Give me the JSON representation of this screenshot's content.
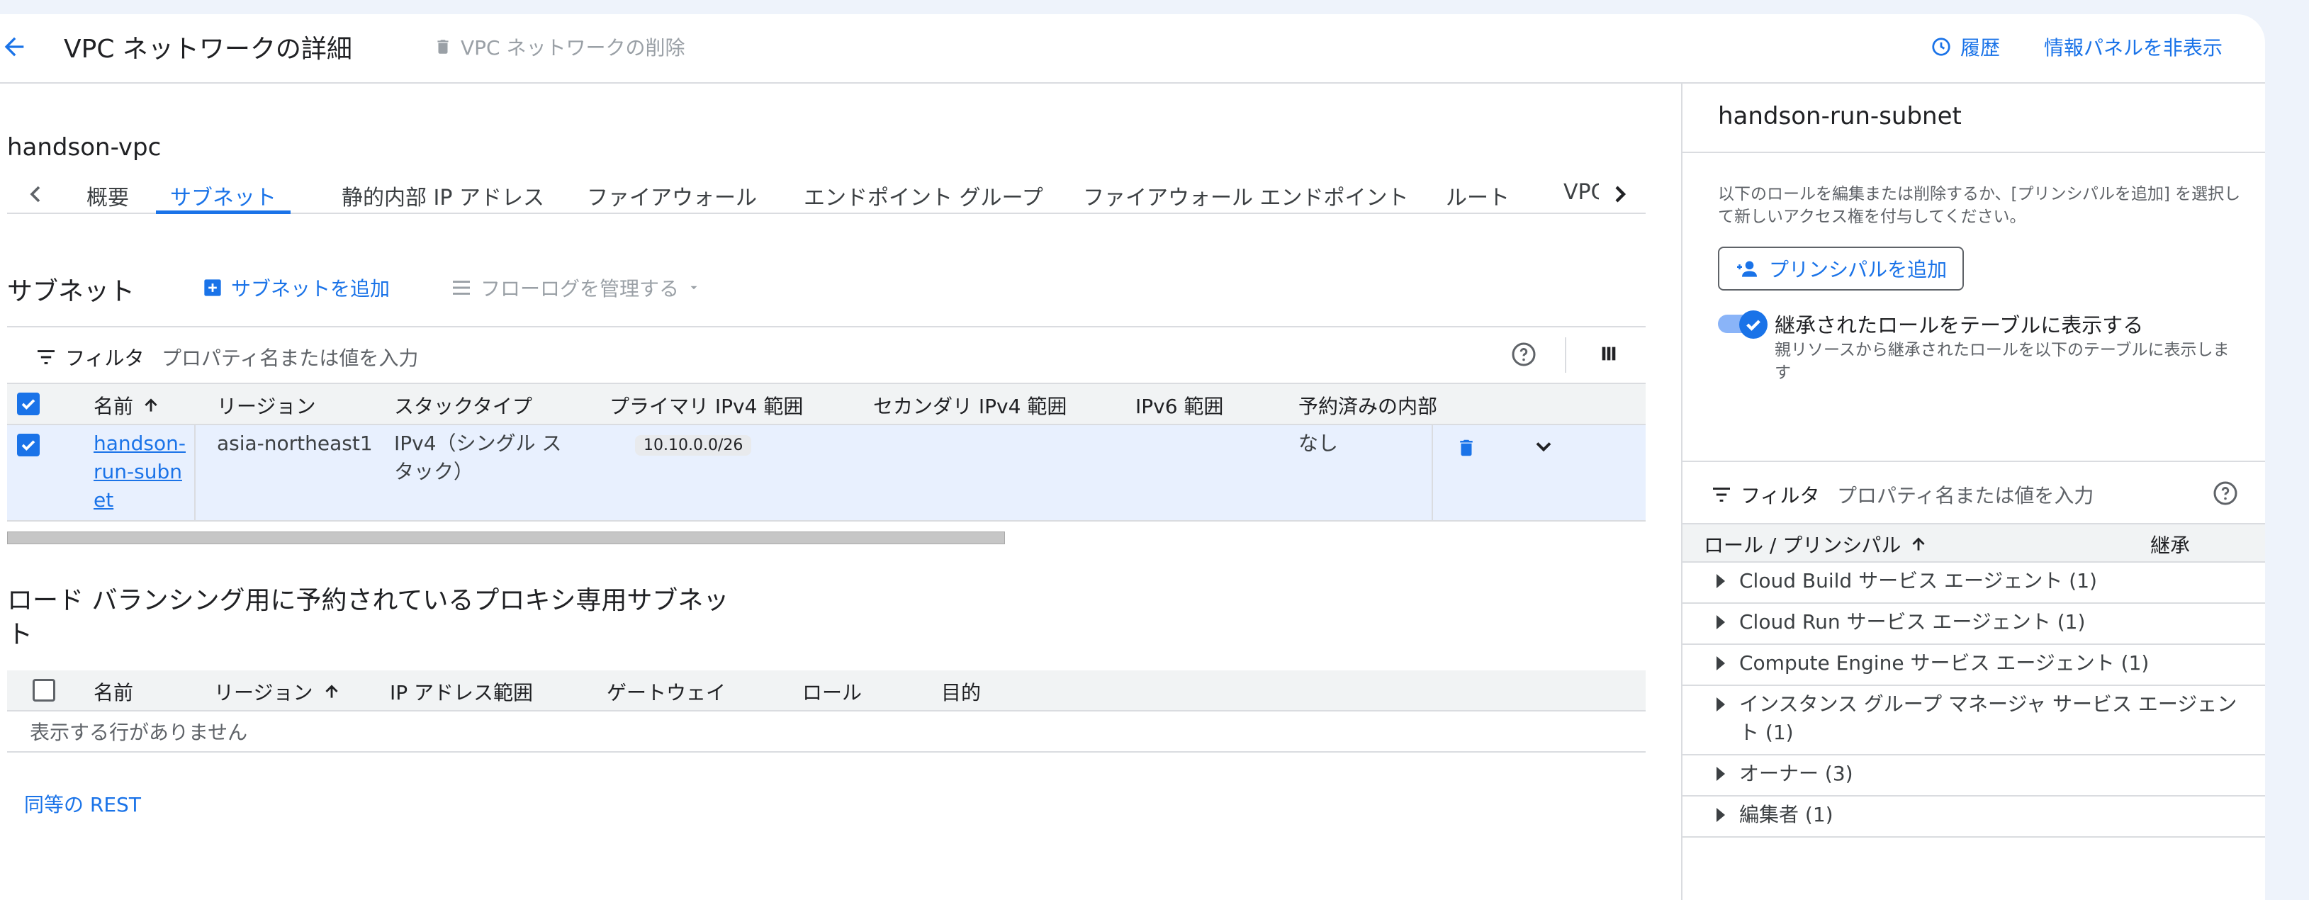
{
  "header": {
    "title": "VPC ネットワークの詳細",
    "delete_label": "VPC ネットワークの削除",
    "history_label": "履歴",
    "hide_panel_label": "情報パネルを非表示"
  },
  "vpc": {
    "name": "handson-vpc",
    "tabs": [
      "概要",
      "サブネット",
      "静的内部 IP アドレス",
      "ファイアウォール",
      "エンドポイント グループ",
      "ファイアウォール エンドポイント",
      "ルート",
      "VPC"
    ]
  },
  "subnets": {
    "title": "サブネット",
    "add_label": "サブネットを追加",
    "flowlog_label": "フローログを管理する",
    "filter_label": "フィルタ",
    "filter_placeholder": "プロパティ名または値を入力",
    "columns": [
      "名前",
      "リージョン",
      "スタックタイプ",
      "プライマリ IPv4 範囲",
      "セカンダリ IPv4 範囲",
      "IPv6 範囲",
      "予約済みの内部"
    ],
    "rows": [
      {
        "name": "handson-run-subnet",
        "region": "asia-northeast1",
        "stack_type": "IPv4（シングル スタック）",
        "primary_ipv4": "10.10.0.0/26",
        "reserved_internal": "なし"
      }
    ]
  },
  "proxy": {
    "title": "ロード バランシング用に予約されているプロキシ専用サブネット",
    "columns": [
      "名前",
      "リージョン",
      "IP アドレス範囲",
      "ゲートウェイ",
      "ロール",
      "目的"
    ],
    "empty_text": "表示する行がありません"
  },
  "rest_label": "同等の REST",
  "info_panel": {
    "title": "handson-run-subnet",
    "description": "以下のロールを編集または削除するか、[プリンシパルを追加] を選択して新しいアクセス権を付与してください。",
    "add_principal_label": "プリンシパルを追加",
    "toggle_label": "継承されたロールをテーブルに表示する",
    "toggle_on": true,
    "toggle_sub": "親リソースから継承されたロールを以下のテーブルに表示します",
    "filter_label": "フィルタ",
    "filter_placeholder": "プロパティ名または値を入力",
    "columns": [
      "ロール / プリンシパル",
      "継承"
    ],
    "roles": [
      "Cloud Build サービス エージェント (1)",
      "Cloud Run サービス エージェント (1)",
      "Compute Engine サービス エージェント (1)",
      "インスタンス グループ マネージャ サービス エージェント (1)",
      "オーナー (3)",
      "編集者 (1)"
    ]
  },
  "colors": {
    "accent": "#1a73e8",
    "row_selected": "#e8f0fe",
    "header_bg": "#f1f3f4"
  }
}
